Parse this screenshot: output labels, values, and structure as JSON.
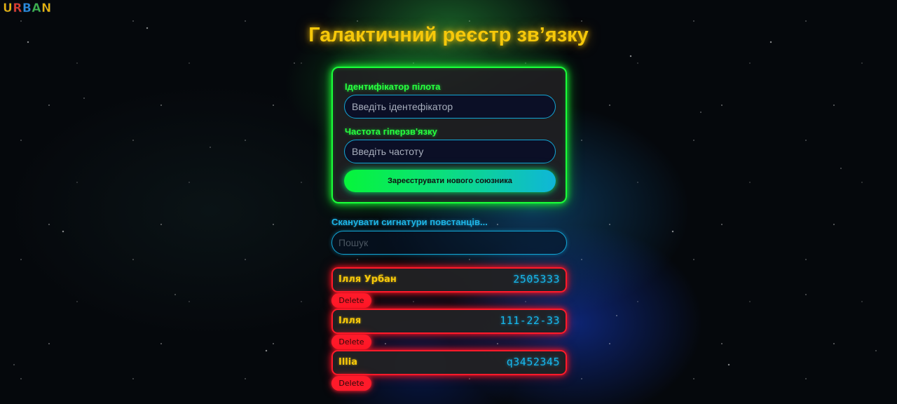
{
  "logo": {
    "letters": [
      "U",
      "R",
      "B",
      "A",
      "N"
    ],
    "colors": [
      "#e8b10b",
      "#e23b2e",
      "#2a8de0",
      "#3fb54a",
      "#e8b10b"
    ]
  },
  "title": "Галактичний реєстр зв’язку",
  "form": {
    "pilot_id_label": "Ідентифікатор пілота",
    "pilot_id_placeholder": "Введіть ідентефікатор",
    "frequency_label": "Частота гіперзв'язку",
    "frequency_placeholder": "Введіть частоту",
    "submit_label": "Зареєструвати нового союзника"
  },
  "search": {
    "label": "Сканувати сигнатури повстанців...",
    "placeholder": "Пошук"
  },
  "contacts": [
    {
      "name": "Ілля Урбан",
      "phone": "2505333",
      "delete_label": "Delete"
    },
    {
      "name": "Ілля",
      "phone": "111-22-33",
      "delete_label": "Delete"
    },
    {
      "name": "Illia",
      "phone": "q3452345",
      "delete_label": "Delete"
    }
  ],
  "colors": {
    "title": "#f6c80a",
    "form_border": "#1aff3a",
    "search_accent": "#1eb4e6",
    "contact_border": "#ff1a2a",
    "phone": "#17b7ec"
  }
}
